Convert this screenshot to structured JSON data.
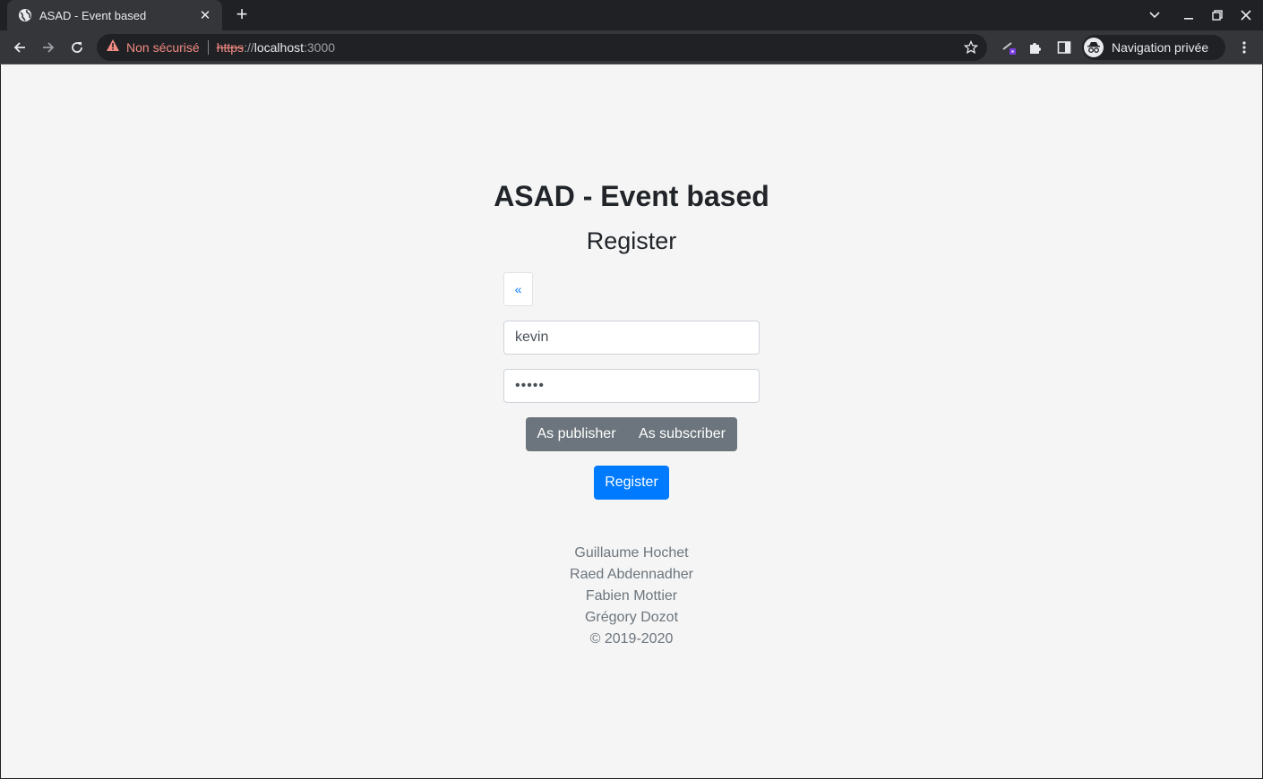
{
  "browser": {
    "tab": {
      "title": "ASAD - Event based"
    },
    "address": {
      "security_label": "Non sécurisé",
      "scheme": "https",
      "separator": "://",
      "host": "localhost",
      "port": ":3000"
    },
    "profile": {
      "label": "Navigation privée"
    },
    "colors": {
      "warning": "#f28b82",
      "frame": "#202124",
      "toolbar": "#35363a"
    }
  },
  "page": {
    "title": "ASAD - Event based",
    "subtitle": "Register",
    "back_label": "«",
    "username": {
      "value": "kevin"
    },
    "password": {
      "value": "•••••"
    },
    "role_toggle": {
      "publisher": "As publisher",
      "subscriber": "As subscriber"
    },
    "submit_label": "Register",
    "footer": [
      "Guillaume Hochet",
      "Raed Abdennadher",
      "Fabien Mottier",
      "Grégory Dozot",
      "© 2019-2020"
    ],
    "colors": {
      "primary": "#007bff",
      "secondary": "#6c757d",
      "background": "#f5f5f5"
    }
  }
}
